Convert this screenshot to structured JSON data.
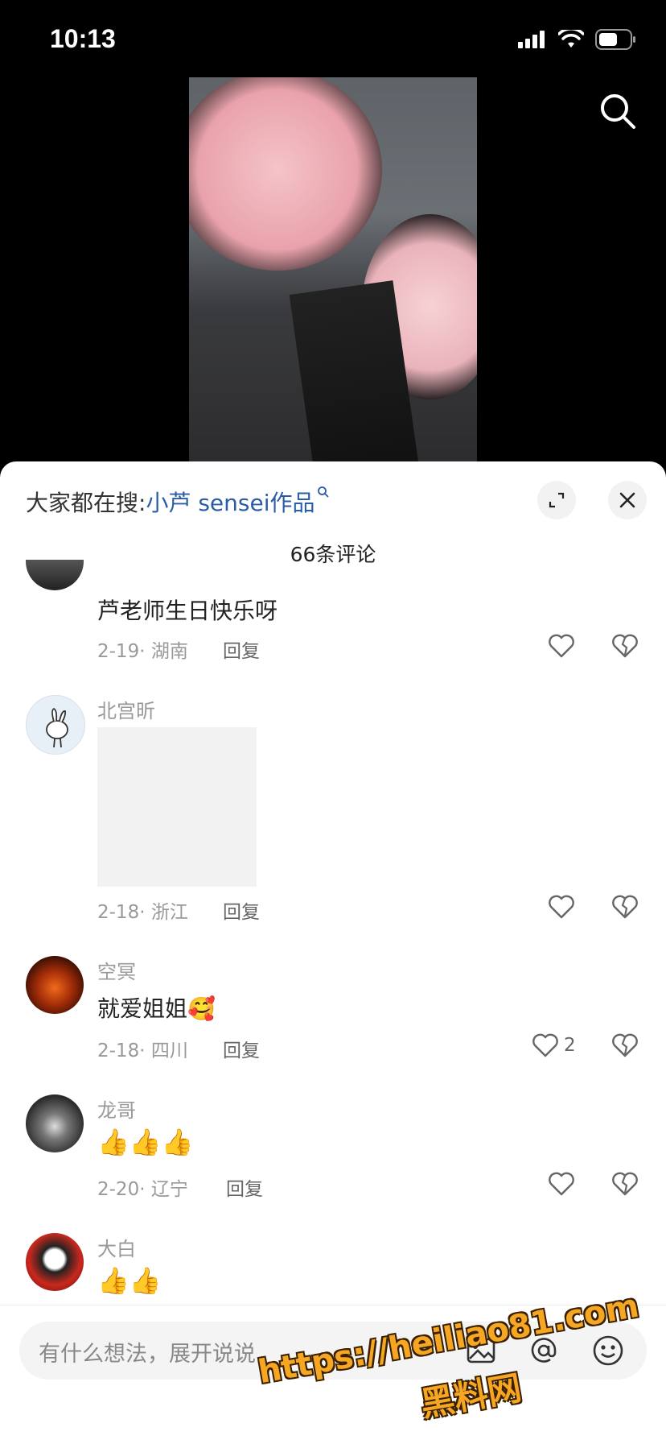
{
  "status": {
    "time": "10:13"
  },
  "sheet": {
    "search_prefix": "大家都在搜:",
    "search_keyword": "小芦 sensei作品",
    "comment_count": "66条评论"
  },
  "comments": [
    {
      "text": "芦老师生日快乐呀",
      "date": "2-19",
      "location": "湖南",
      "reply": "回复"
    },
    {
      "user": "北宫昕",
      "date": "2-18",
      "location": "浙江",
      "reply": "回复"
    },
    {
      "user": "空冥",
      "text": "就爱姐姐",
      "emoji": "🥰",
      "date": "2-18",
      "location": "四川",
      "reply": "回复",
      "likes": "2"
    },
    {
      "user": "龙哥",
      "emoji": "👍👍👍",
      "date": "2-20",
      "location": "辽宁",
      "reply": "回复"
    },
    {
      "user": "大白",
      "emoji": "👍👍"
    }
  ],
  "input": {
    "placeholder": "有什么想法，展开说说"
  },
  "watermark": {
    "line1": "https://heiliao81.com",
    "line2": "黑料网"
  }
}
